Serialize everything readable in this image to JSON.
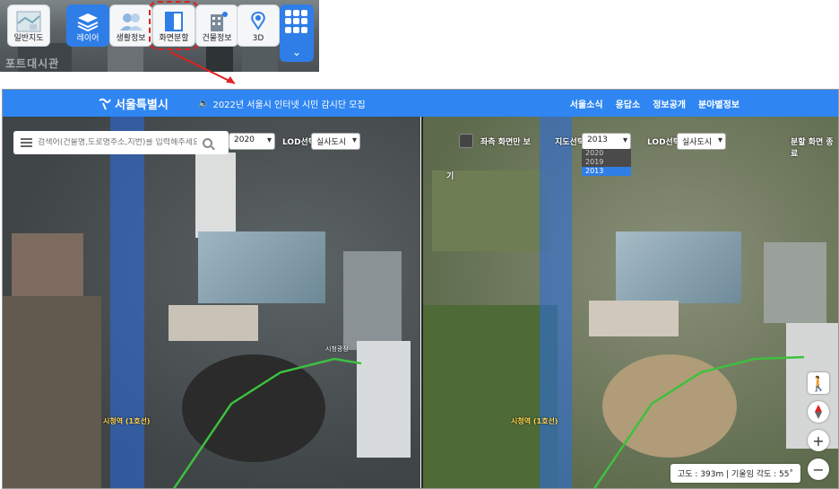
{
  "toolbar": {
    "buttons": [
      {
        "label": "일반지도",
        "icon": "map-icon"
      },
      {
        "label": "레이어",
        "icon": "layers-icon"
      },
      {
        "label": "생활정보",
        "icon": "people-icon"
      },
      {
        "label": "화면분할",
        "icon": "split-screen-icon"
      },
      {
        "label": "건물정보",
        "icon": "building-icon"
      },
      {
        "label": "3D",
        "icon": "pin-3d-icon"
      }
    ],
    "grid_icon": "grid-menu-icon",
    "chevron_icon": "chevron-down-icon",
    "faded_text": "포트대시관"
  },
  "header": {
    "logo": "서울특별시",
    "notice": "2022년 서울시 인터넷 시민 감시단 모집",
    "nav": [
      "서울소식",
      "응답소",
      "정보공개",
      "분야별정보"
    ]
  },
  "left_pane": {
    "search_placeholder": "검색어(건물명,도로명주소,지번)를 입력해주세요",
    "year_select": "2020",
    "lod_label": "LOD선택",
    "lod_select": "실사도시",
    "station": "시청역 (1호선)",
    "poi_label": "시청광장"
  },
  "right_pane": {
    "left_only_label": "좌측 화면만 보",
    "map_select_label": "지도선택",
    "year_select": "2013",
    "year_options": [
      "2020",
      "2019",
      "2013"
    ],
    "selected_option": "2013",
    "lod_label": "LOD선택",
    "lod_select": "실사도시",
    "exit_split": "분할 화면 종료",
    "corner_text": "기",
    "station": "시청역 (1호선)",
    "status": "고도 : 393m  |  기울임 각도 : 55˚"
  },
  "colors": {
    "header": "#2f86f2",
    "active_button": "#2f7ee8",
    "highlight": "#e02020",
    "metro_line": "#2f6ee6",
    "walk_path": "#3fbf3f"
  }
}
